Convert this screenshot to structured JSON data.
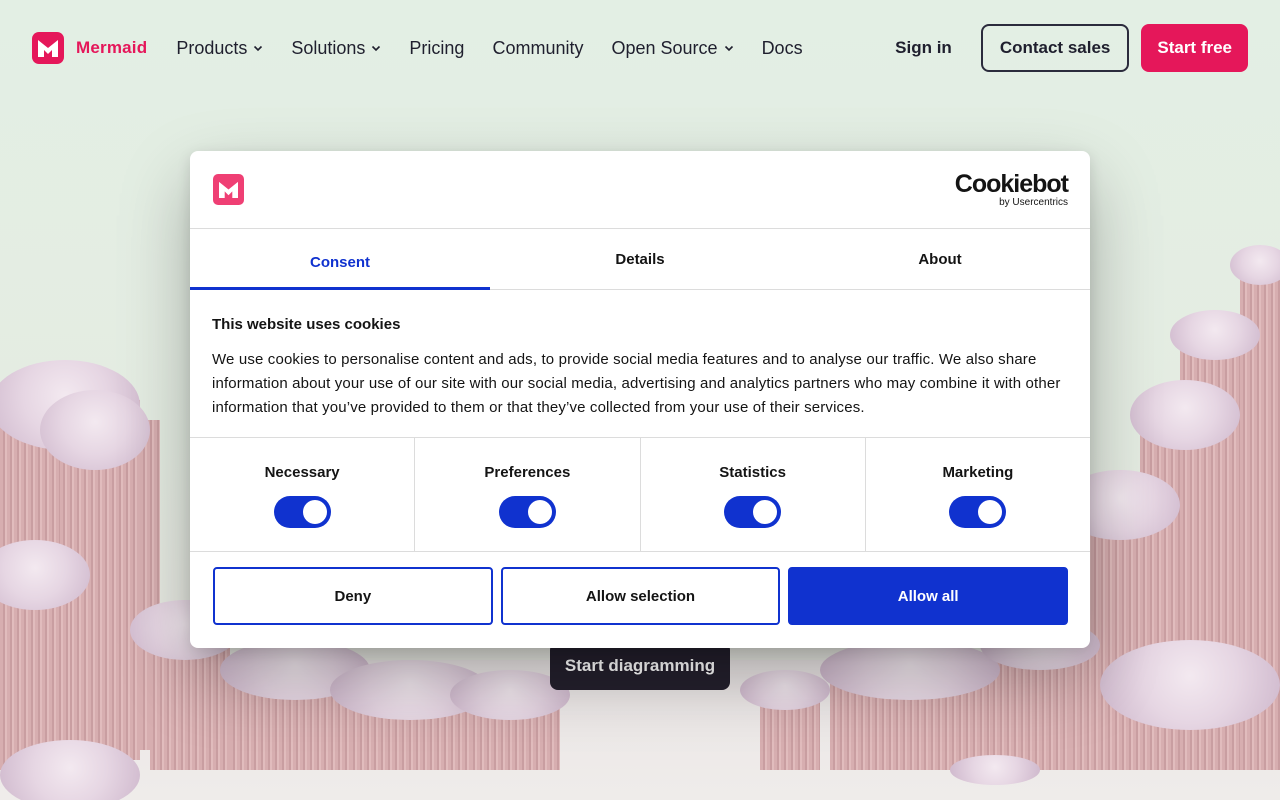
{
  "brand": {
    "name": "Mermaid",
    "accent": "#e5175a",
    "logo_icon": "mermaid-logo-icon"
  },
  "nav": {
    "links": [
      {
        "label": "Products",
        "has_dropdown": true
      },
      {
        "label": "Solutions",
        "has_dropdown": true
      },
      {
        "label": "Pricing",
        "has_dropdown": false
      },
      {
        "label": "Community",
        "has_dropdown": false
      },
      {
        "label": "Open Source",
        "has_dropdown": true
      },
      {
        "label": "Docs",
        "has_dropdown": false
      }
    ],
    "sign_in": "Sign in",
    "contact_sales": "Contact sales",
    "start_free": "Start free"
  },
  "hero": {
    "cta": "Start diagramming"
  },
  "cookie_dialog": {
    "provider": "Cookiebot",
    "provider_sub": "by Usercentrics",
    "tabs": [
      {
        "label": "Consent",
        "active": true
      },
      {
        "label": "Details",
        "active": false
      },
      {
        "label": "About",
        "active": false
      }
    ],
    "title": "This website uses cookies",
    "description": "We use cookies to personalise content and ads, to provide social media features and to analyse our traffic. We also share information about your use of our site with our social media, advertising and analytics partners who may combine it with other information that you’ve provided to them or that they’ve collected from your use of their services.",
    "categories": [
      {
        "label": "Necessary",
        "enabled": true
      },
      {
        "label": "Preferences",
        "enabled": true
      },
      {
        "label": "Statistics",
        "enabled": true
      },
      {
        "label": "Marketing",
        "enabled": true
      }
    ],
    "buttons": {
      "deny": "Deny",
      "allow_selection": "Allow selection",
      "allow_all": "Allow all"
    },
    "accent": "#1032cf"
  }
}
